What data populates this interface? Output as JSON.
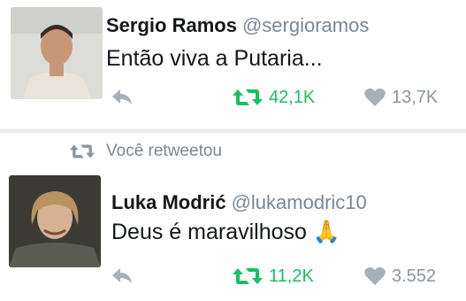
{
  "tweets": [
    {
      "name": "Sergio Ramos",
      "handle": "@sergioramos",
      "text": "Então viva a Putaria...",
      "retweets": "42,1K",
      "likes": "13,7K"
    },
    {
      "name": "Luka Modrić",
      "handle": "@lukamodric10",
      "text": "Deus é maravilhoso",
      "emoji": "🙏",
      "retweets": "11,2K",
      "likes": "3.552"
    }
  ],
  "retweet_notice": "Você retweetou",
  "colors": {
    "retweet_green": "#17bf63",
    "muted_gray": "#7a8792",
    "divider": "#e9edf1"
  },
  "icons": [
    "reply-icon",
    "retweet-icon",
    "heart-icon"
  ]
}
